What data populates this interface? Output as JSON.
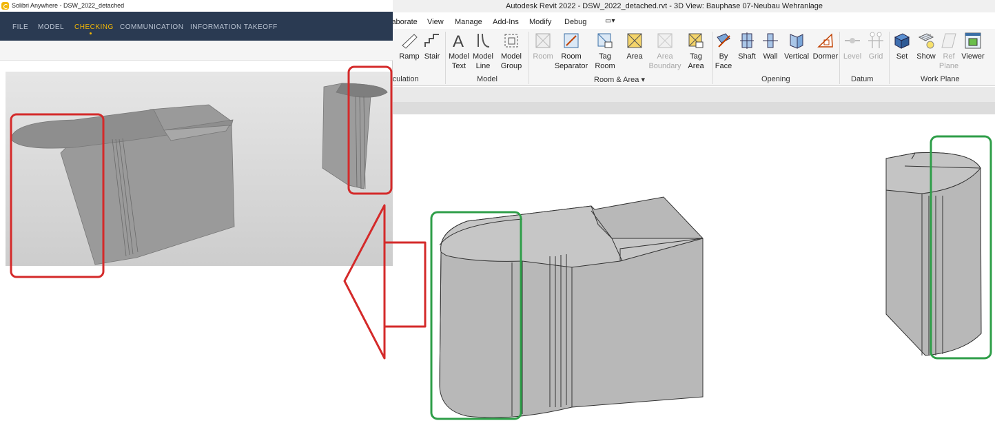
{
  "solibri": {
    "window_title": "Solibri Anywhere - DSW_2022_detached",
    "tabs": [
      {
        "label": "FILE",
        "active": false
      },
      {
        "label": "MODEL",
        "active": false
      },
      {
        "label": "CHECKING",
        "active": true
      },
      {
        "label": "COMMUNICATION",
        "active": false
      },
      {
        "label": "INFORMATION TAKEOFF",
        "active": false
      }
    ],
    "colors": {
      "nav_bg": "#2a3a52",
      "active_tab": "#f2b705"
    }
  },
  "revit": {
    "window_title": "Autodesk Revit 2022 - DSW_2022_detached.rvt - 3D View: Bauphase 07-Neubau Wehranlage",
    "menu": [
      "laborate",
      "View",
      "Manage",
      "Add-Ins",
      "Modify",
      "Debug"
    ],
    "ribbon": {
      "circulation": {
        "buttons": [
          "Ramp",
          "Stair"
        ],
        "title": "rculation"
      },
      "model": {
        "buttons": [
          [
            "Model",
            "Text"
          ],
          [
            "Model",
            "Line"
          ],
          [
            "Model",
            "Group"
          ]
        ],
        "title": "Model"
      },
      "room_area": {
        "buttons": [
          [
            "Room",
            ""
          ],
          [
            "Room",
            "Separator"
          ],
          [
            "Tag",
            "Room"
          ],
          [
            "Area",
            ""
          ],
          [
            "Area",
            "Boundary"
          ],
          [
            "Tag",
            "Area"
          ]
        ],
        "title": "Room & Area"
      },
      "opening": {
        "buttons": [
          [
            "By",
            "Face"
          ],
          [
            "Shaft",
            ""
          ],
          [
            "Wall",
            ""
          ],
          [
            "Vertical",
            ""
          ],
          [
            "Dormer",
            ""
          ]
        ],
        "title": "Opening"
      },
      "datum": {
        "buttons": [
          "Level",
          "Grid"
        ],
        "title": "Datum"
      },
      "work_plane": {
        "buttons": [
          [
            "Set",
            ""
          ],
          [
            "Show",
            ""
          ],
          [
            "Ref",
            "Plane"
          ],
          [
            "Viewer",
            ""
          ]
        ],
        "title": "Work Plane"
      }
    },
    "colors": {
      "highlight": "#2e9e48"
    }
  },
  "annotation": {
    "solibri_highlight": "#d42a2a",
    "revit_highlight": "#2e9e48",
    "arrow": "#d42a2a"
  }
}
